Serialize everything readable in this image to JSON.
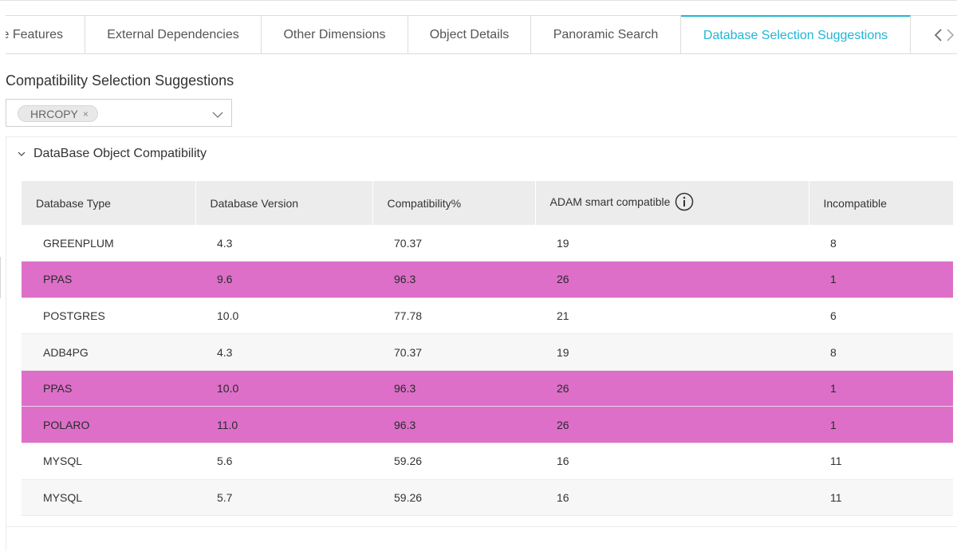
{
  "tabs": [
    {
      "label": "e Features"
    },
    {
      "label": "External Dependencies"
    },
    {
      "label": "Other Dimensions"
    },
    {
      "label": "Object Details"
    },
    {
      "label": "Panoramic Search"
    },
    {
      "label": "Database Selection Suggestions",
      "active": true
    }
  ],
  "section": {
    "title": "Compatibility Selection Suggestions"
  },
  "select": {
    "tag": "HRCOPY",
    "tag_close": "×"
  },
  "panel": {
    "title": "DataBase Object Compatibility"
  },
  "table": {
    "headers": [
      "Database Type",
      "Database Version",
      "Compatibility%",
      "ADAM smart compatible",
      "Incompatible"
    ],
    "rows": [
      {
        "type": "GREENPLUM",
        "version": "4.3",
        "compat": "70.37",
        "adam": "19",
        "incompat": "8",
        "highlight": false
      },
      {
        "type": "PPAS",
        "version": "9.6",
        "compat": "96.3",
        "adam": "26",
        "incompat": "1",
        "highlight": true
      },
      {
        "type": "POSTGRES",
        "version": "10.0",
        "compat": "77.78",
        "adam": "21",
        "incompat": "6",
        "highlight": false
      },
      {
        "type": "ADB4PG",
        "version": "4.3",
        "compat": "70.37",
        "adam": "19",
        "incompat": "8",
        "highlight": false
      },
      {
        "type": "PPAS",
        "version": "10.0",
        "compat": "96.3",
        "adam": "26",
        "incompat": "1",
        "highlight": true
      },
      {
        "type": "POLARO",
        "version": "11.0",
        "compat": "96.3",
        "adam": "26",
        "incompat": "1",
        "highlight": true
      },
      {
        "type": "MYSQL",
        "version": "5.6",
        "compat": "59.26",
        "adam": "16",
        "incompat": "11",
        "highlight": false
      },
      {
        "type": "MYSQL",
        "version": "5.7",
        "compat": "59.26",
        "adam": "16",
        "incompat": "11",
        "highlight": false
      }
    ]
  },
  "colors": {
    "accent": "#1fb7d4",
    "highlight_row": "#dd6fc9",
    "header_bg": "#ececec"
  },
  "icons": {
    "tab_prev": "chevron-left-icon",
    "tab_next": "chevron-right-icon",
    "select_arrow": "chevron-down-icon",
    "collapse": "chevron-down-icon",
    "info": "info-icon"
  }
}
